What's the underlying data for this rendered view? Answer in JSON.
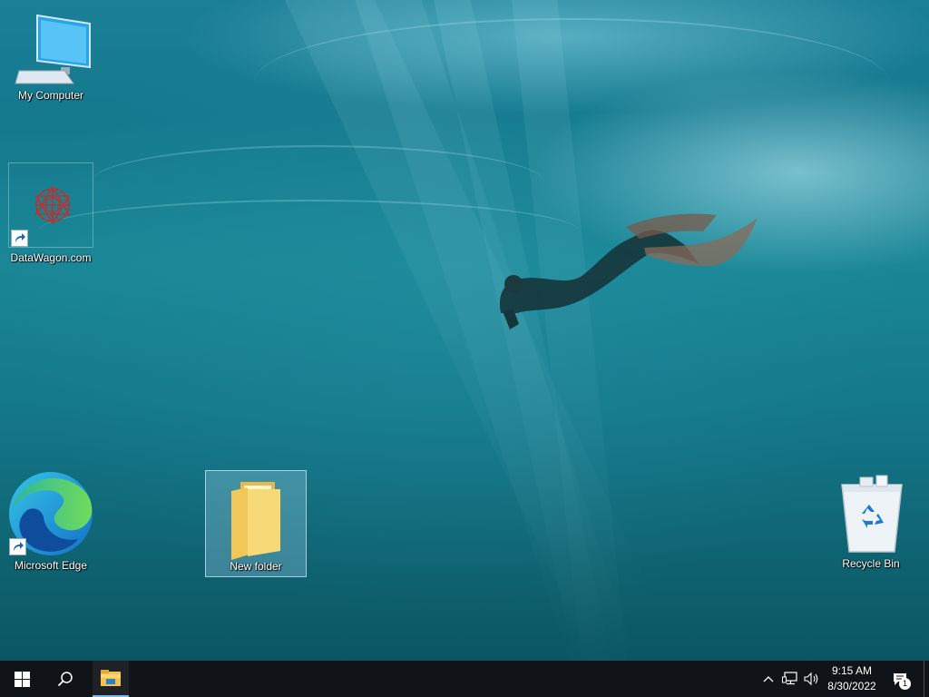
{
  "desktop": {
    "icons": [
      {
        "label": "My Computer",
        "icon": "computer-icon"
      },
      {
        "label": "DataWagon.com",
        "icon": "datawagon-icon",
        "shortcut": true
      },
      {
        "label": "Microsoft Edge",
        "icon": "edge-icon",
        "shortcut": true
      },
      {
        "label": "New folder",
        "icon": "folder-icon",
        "selected": true
      },
      {
        "label": "Recycle Bin",
        "icon": "recycle-bin-icon"
      }
    ]
  },
  "taskbar": {
    "start": "windows-start-icon",
    "search": "search-icon",
    "pinned": [
      {
        "app": "File Explorer",
        "icon": "file-explorer-icon",
        "active": true
      }
    ],
    "tray": {
      "icons": [
        "chevron-up-icon",
        "network-icon",
        "volume-icon"
      ],
      "time": "9:15 AM",
      "date": "8/30/2022",
      "notification_count": "1"
    }
  },
  "colors": {
    "taskbar": "#101418",
    "accent": "#00a2ed",
    "folder": "#f6d26a"
  }
}
